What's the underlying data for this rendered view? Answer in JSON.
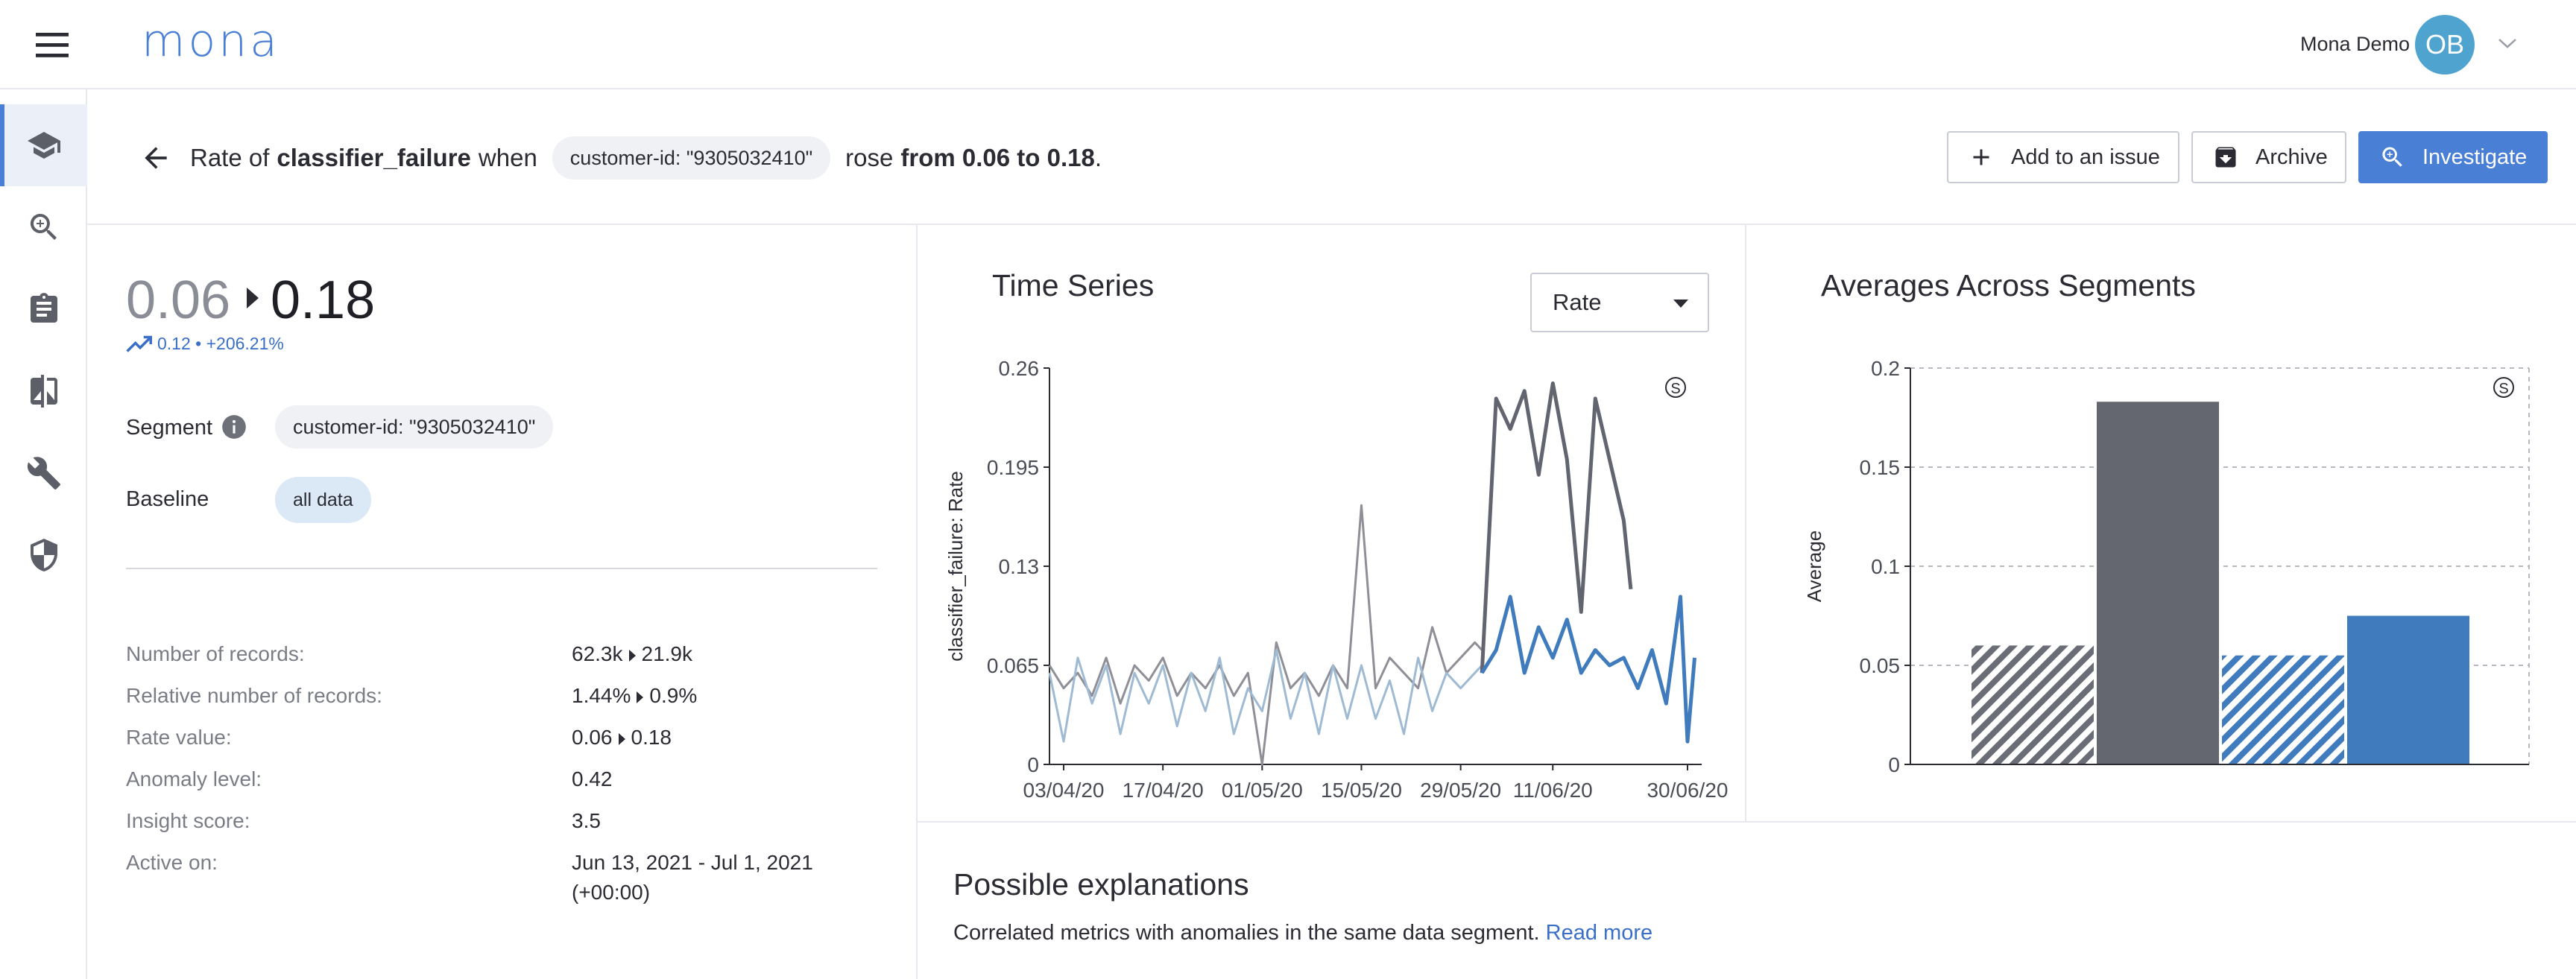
{
  "app": {
    "logo": "mona",
    "user_name": "Mona Demo",
    "avatar_initials": "OB",
    "accent_color": "#4a7fd6"
  },
  "sidebar": {
    "items": [
      {
        "icon": "school-icon",
        "active": true
      },
      {
        "icon": "search-zoom-icon",
        "active": false
      },
      {
        "icon": "clipboard-icon",
        "active": false
      },
      {
        "icon": "compare-icon",
        "active": false
      },
      {
        "icon": "wrench-icon",
        "active": false
      },
      {
        "icon": "shield-icon",
        "active": false
      }
    ]
  },
  "header": {
    "prefix": "Rate of",
    "metric": "classifier_failure",
    "when": "when",
    "segment_chip": "customer-id: \"9305032410\"",
    "rose": "rose",
    "change": "from 0.06 to 0.18",
    "period": ".",
    "buttons": {
      "add_issue": "Add to an issue",
      "archive": "Archive",
      "investigate": "Investigate"
    }
  },
  "summary": {
    "from": "0.06",
    "to": "0.18",
    "delta": "0.12 • +206.21%",
    "segment_label": "Segment",
    "segment_value": "customer-id: \"9305032410\"",
    "baseline_label": "Baseline",
    "baseline_value": "all data"
  },
  "stats": [
    {
      "label": "Number of records:",
      "from": "62.3k",
      "to": "21.9k"
    },
    {
      "label": "Relative number of records:",
      "from": "1.44%",
      "to": "0.9%"
    },
    {
      "label": "Rate value:",
      "from": "0.06",
      "to": "0.18"
    },
    {
      "label": "Anomaly level:",
      "value": "0.42"
    },
    {
      "label": "Insight score:",
      "value": "3.5"
    },
    {
      "label": "Active on:",
      "value": "Jun 13, 2021 - Jul 1, 2021",
      "value2": "(+00:00)"
    }
  ],
  "time_series_panel": {
    "title": "Time Series",
    "select_value": "Rate"
  },
  "averages_panel": {
    "title": "Averages Across Segments"
  },
  "explanations": {
    "title": "Possible explanations",
    "text": "Correlated metrics with anomalies in the same data segment.",
    "link": "Read more"
  },
  "chart_data": [
    {
      "type": "line",
      "title": "Time Series",
      "ylabel": "classifier_failure: Rate",
      "xlabel": "",
      "ylim": [
        0,
        0.26
      ],
      "yticks": [
        "0",
        "0.065",
        "0.13",
        "0.195",
        "0.26"
      ],
      "xticks": [
        "03/04/20",
        "17/04/20",
        "01/05/20",
        "15/05/20",
        "29/05/20",
        "11/06/20",
        "30/06/20"
      ],
      "x_start": "2020-04-01",
      "x_end": "2020-07-02",
      "grid": false,
      "corner_badge": "S",
      "series": [
        {
          "color": "#8f8f98",
          "dates": [
            "2020-04-01",
            "2020-04-03",
            "2020-04-05",
            "2020-04-07",
            "2020-04-09",
            "2020-04-11",
            "2020-04-13",
            "2020-04-15",
            "2020-04-17",
            "2020-04-19",
            "2020-04-21",
            "2020-04-23",
            "2020-04-25",
            "2020-04-27",
            "2020-04-29",
            "2020-05-01",
            "2020-05-03",
            "2020-05-05",
            "2020-05-07",
            "2020-05-09",
            "2020-05-11",
            "2020-05-13",
            "2020-05-15",
            "2020-05-17",
            "2020-05-19",
            "2020-05-21",
            "2020-05-23",
            "2020-05-25",
            "2020-05-27",
            "2020-05-29",
            "2020-05-31",
            "2020-06-01"
          ],
          "values": [
            0.065,
            0.05,
            0.06,
            0.045,
            0.07,
            0.04,
            0.065,
            0.055,
            0.07,
            0.045,
            0.06,
            0.05,
            0.065,
            0.045,
            0.06,
            0.0,
            0.08,
            0.05,
            0.06,
            0.045,
            0.065,
            0.05,
            0.17,
            0.05,
            0.07,
            0.06,
            0.05,
            0.09,
            0.06,
            0.07,
            0.08,
            0.075
          ]
        },
        {
          "color": "#9fbad3",
          "dates": [
            "2020-04-01",
            "2020-04-03",
            "2020-04-05",
            "2020-04-07",
            "2020-04-09",
            "2020-04-11",
            "2020-04-13",
            "2020-04-15",
            "2020-04-17",
            "2020-04-19",
            "2020-04-21",
            "2020-04-23",
            "2020-04-25",
            "2020-04-27",
            "2020-04-29",
            "2020-05-01",
            "2020-05-03",
            "2020-05-05",
            "2020-05-07",
            "2020-05-09",
            "2020-05-11",
            "2020-05-13",
            "2020-05-15",
            "2020-05-17",
            "2020-05-19",
            "2020-05-21",
            "2020-05-23",
            "2020-05-25",
            "2020-05-27",
            "2020-05-29",
            "2020-05-31",
            "2020-06-01"
          ],
          "values": [
            0.06,
            0.015,
            0.07,
            0.04,
            0.065,
            0.02,
            0.06,
            0.04,
            0.065,
            0.025,
            0.06,
            0.035,
            0.07,
            0.02,
            0.05,
            0.035,
            0.075,
            0.03,
            0.06,
            0.02,
            0.065,
            0.03,
            0.065,
            0.03,
            0.055,
            0.02,
            0.07,
            0.035,
            0.06,
            0.05,
            0.06,
            0.065
          ]
        },
        {
          "color": "#626570",
          "dates": [
            "2020-06-01",
            "2020-06-03",
            "2020-06-05",
            "2020-06-07",
            "2020-06-09",
            "2020-06-11",
            "2020-06-13",
            "2020-06-15",
            "2020-06-17",
            "2020-06-19",
            "2020-06-21",
            "2020-06-22"
          ],
          "values": [
            0.06,
            0.24,
            0.22,
            0.245,
            0.19,
            0.25,
            0.2,
            0.1,
            0.24,
            0.2,
            0.16,
            0.115
          ]
        },
        {
          "color": "#3f7bbd",
          "dates": [
            "2020-06-01",
            "2020-06-03",
            "2020-06-05",
            "2020-06-07",
            "2020-06-09",
            "2020-06-11",
            "2020-06-13",
            "2020-06-15",
            "2020-06-17",
            "2020-06-19",
            "2020-06-21",
            "2020-06-23",
            "2020-06-25",
            "2020-06-27",
            "2020-06-29",
            "2020-06-30",
            "2020-07-01"
          ],
          "values": [
            0.06,
            0.075,
            0.11,
            0.06,
            0.09,
            0.07,
            0.095,
            0.06,
            0.075,
            0.065,
            0.07,
            0.05,
            0.075,
            0.04,
            0.11,
            0.015,
            0.07
          ]
        }
      ]
    },
    {
      "type": "bar",
      "title": "Averages Across Segments",
      "ylabel": "Average",
      "ylim": [
        0,
        0.2
      ],
      "yticks": [
        "0",
        "0.05",
        "0.1",
        "0.15",
        "0.2"
      ],
      "grid": true,
      "corner_badge": "S",
      "bars": [
        {
          "value": 0.06,
          "color": "#6a6d76",
          "hatched": true
        },
        {
          "value": 0.183,
          "color": "#646770",
          "hatched": false
        },
        {
          "value": 0.055,
          "color": "#3f7bbd",
          "hatched": true
        },
        {
          "value": 0.075,
          "color": "#3f7bbd",
          "hatched": false
        }
      ]
    }
  ]
}
